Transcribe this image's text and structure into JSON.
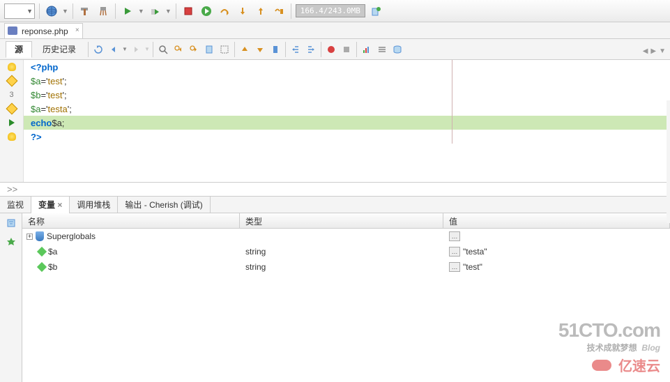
{
  "toolbar": {
    "memory": "166.4/243.0MB"
  },
  "file_tab": {
    "label": "reponse.php"
  },
  "sub_tabs": {
    "source": "源",
    "history": "历史记录"
  },
  "code": {
    "l1": "<?php",
    "l2a": "$a",
    "l2b": "='",
    "l2c": "test",
    "l2d": "';",
    "l3num": "3",
    "l3a": "$b",
    "l3b": "='",
    "l3c": "test",
    "l3d": "';",
    "l4a": "$a",
    "l4b": "='",
    "l4c": "testa",
    "l4d": "';",
    "l5a": "echo",
    "l5b": " $a;",
    "l6": "?>"
  },
  "breadcrumb": ">>",
  "bottom_tabs": {
    "watch": "监视",
    "vars": "变量",
    "callstack": "调用堆栈",
    "output": "输出 - Cherish (调试)"
  },
  "vars_panel": {
    "headers": {
      "name": "名称",
      "type": "类型",
      "value": "值"
    },
    "rows": [
      {
        "name": "Superglobals",
        "type": "",
        "value": "",
        "icon": "shield",
        "expandable": true
      },
      {
        "name": "$a",
        "type": "string",
        "value": "\"testa\"",
        "icon": "diamond"
      },
      {
        "name": "$b",
        "type": "string",
        "value": "\"test\"",
        "icon": "diamond"
      }
    ]
  },
  "watermark": {
    "main": "51CTO.com",
    "sub1": "技术成就梦想",
    "sub2": "Blog",
    "ys": "亿速云"
  }
}
